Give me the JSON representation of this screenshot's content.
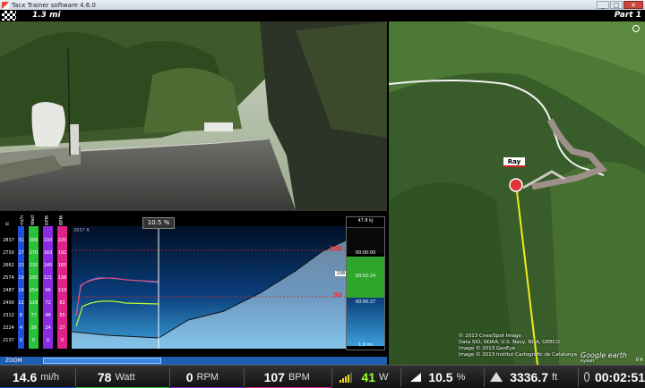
{
  "window": {
    "title": "Tacx Trainer software 4.6.0",
    "minimize": "_",
    "maximize": "□",
    "close": "✕"
  },
  "topbar": {
    "distance": "1.3 mi",
    "part": "Part 1"
  },
  "graph": {
    "grade_label": "10.5 %",
    "columns": [
      {
        "header": "ft",
        "color": "#000000"
      },
      {
        "header": "mi/h",
        "color": "#1f4ed8"
      },
      {
        "header": "Watt",
        "color": "#27c23a"
      },
      {
        "header": "RPM",
        "color": "#8a2be2"
      },
      {
        "header": "BPM",
        "color": "#e0218a"
      }
    ],
    "rows": [
      [
        "2837",
        "31",
        "309",
        "193",
        "220"
      ],
      [
        "2750",
        "27",
        "270",
        "169",
        "192"
      ],
      [
        "2662",
        "23",
        "232",
        "145",
        "165"
      ],
      [
        "2574",
        "19",
        "193",
        "121",
        "138"
      ],
      [
        "2487",
        "16",
        "154",
        "96",
        "110"
      ],
      [
        "2400",
        "12",
        "116",
        "72",
        "82"
      ],
      [
        "2312",
        "8",
        "77",
        "48",
        "55"
      ],
      [
        "2224",
        "4",
        "39",
        "24",
        "27"
      ],
      [
        "2137",
        "0",
        "0",
        "0",
        "0"
      ]
    ],
    "top_alt_label": "2837 ft",
    "bottom_alt_label": "2137 ft",
    "hr_high": "180",
    "hr_low": "90",
    "current_hr_marker": "108",
    "side": {
      "energy": "47.8 kJ",
      "time_start": "00:00:00",
      "time_elapsed": "00:02:24",
      "time_remaining": "00:00:27",
      "total_distance": "1.9 mi"
    }
  },
  "zoom": {
    "label": "ZOOM"
  },
  "map": {
    "rider_name": "Ray",
    "credits": [
      "© 2013 Cnes/Spot Image",
      "Data SIO, NOAA, U.S. Navy, NGA, GEBCO",
      "Image © 2013 GeoEye",
      "Image © 2013 Institut Cartogràfic de Catalunya"
    ],
    "brand": "Google earth",
    "brand_sub": "eyealt",
    "scale": "0 ft"
  },
  "metrics": {
    "speed": {
      "value": "14.6",
      "unit": "mi/h",
      "color": "#1f4ed8"
    },
    "power": {
      "value": "78",
      "unit": "Watt",
      "color": "#27c23a"
    },
    "cadence": {
      "value": "0",
      "unit": "RPM",
      "color": "#8a2be2"
    },
    "heartrate": {
      "value": "107",
      "unit": "BPM",
      "color": "#e0218a"
    },
    "wattage_level": {
      "value": "41",
      "unit": "W",
      "fill": 0.6
    },
    "slope": {
      "value": "10.5",
      "unit": "%"
    },
    "altitude": {
      "value": "3336.7",
      "unit": "ft"
    },
    "time": {
      "value": "00:02:51"
    }
  }
}
